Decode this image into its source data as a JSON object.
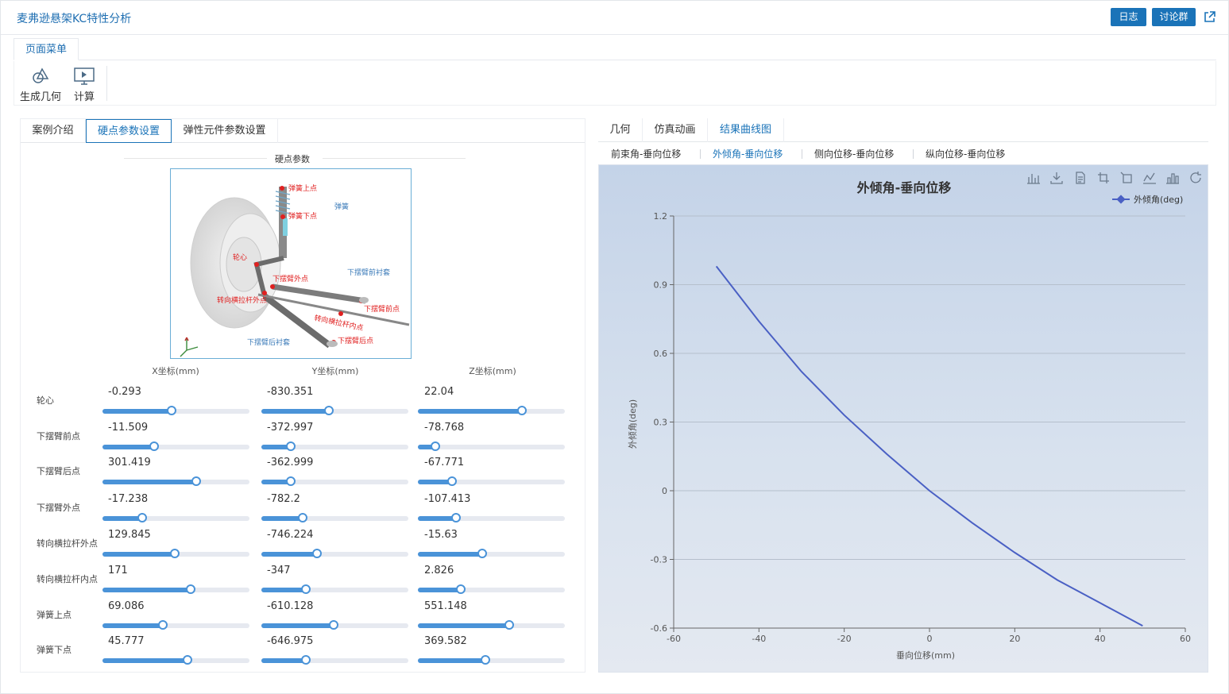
{
  "header": {
    "title": "麦弗逊悬架KC特性分析",
    "log_button": "日志",
    "discuss_button": "讨论群"
  },
  "menu": {
    "tab_label": "页面菜单",
    "tools": [
      {
        "label": "生成几何",
        "icon": "geometry-shapes-icon"
      },
      {
        "label": "计算",
        "icon": "compute-monitor-icon"
      }
    ]
  },
  "left_tabs": [
    "案例介绍",
    "硬点参数设置",
    "弹性元件参数设置"
  ],
  "left_active_tab": "硬点参数设置",
  "hardpoint_section": {
    "title": "硬点参数",
    "columns": [
      "X坐标(mm)",
      "Y坐标(mm)",
      "Z坐标(mm)"
    ],
    "diagram_labels": [
      "弹簧上点",
      "弹簧",
      "弹簧下点",
      "轮心",
      "下摆臂外点",
      "下摆臂前衬套",
      "转向横拉杆外点",
      "下摆臂前点",
      "转向横拉杆内点",
      "下摆臂后衬套",
      "下摆臂后点"
    ],
    "rows": [
      {
        "label": "轮心",
        "values": [
          "-0.293",
          "-830.351",
          "22.04"
        ],
        "fractions": [
          0.47,
          0.46,
          0.71
        ]
      },
      {
        "label": "下摆臂前点",
        "values": [
          "-11.509",
          "-372.997",
          "-78.768"
        ],
        "fractions": [
          0.35,
          0.2,
          0.12
        ]
      },
      {
        "label": "下摆臂后点",
        "values": [
          "301.419",
          "-362.999",
          "-67.771"
        ],
        "fractions": [
          0.64,
          0.2,
          0.23
        ]
      },
      {
        "label": "下摆臂外点",
        "values": [
          "-17.238",
          "-782.2",
          "-107.413"
        ],
        "fractions": [
          0.27,
          0.28,
          0.26
        ]
      },
      {
        "label": "转向横拉杆外点",
        "values": [
          "129.845",
          "-746.224",
          "-15.63"
        ],
        "fractions": [
          0.49,
          0.38,
          0.44
        ]
      },
      {
        "label": "转向横拉杆内点",
        "values": [
          "171",
          "-347",
          "2.826"
        ],
        "fractions": [
          0.6,
          0.3,
          0.29
        ]
      },
      {
        "label": "弹簧上点",
        "values": [
          "69.086",
          "-610.128",
          "551.148"
        ],
        "fractions": [
          0.41,
          0.49,
          0.62
        ]
      },
      {
        "label": "弹簧下点",
        "values": [
          "45.777",
          "-646.975",
          "369.582"
        ],
        "fractions": [
          0.58,
          0.3,
          0.46
        ]
      }
    ]
  },
  "right_tabs": [
    "几何",
    "仿真动画",
    "结果曲线图"
  ],
  "right_active_tab": "结果曲线图",
  "sub_tabs": [
    "前束角-垂向位移",
    "外倾角-垂向位移",
    "侧向位移-垂向位移",
    "纵向位移-垂向位移"
  ],
  "sub_active": "外倾角-垂向位移",
  "chart_tools": [
    "bar-stack-icon",
    "download-icon",
    "data-view-icon",
    "zoom-icon",
    "zoom-reset-icon",
    "line-chart-icon",
    "bar-chart-icon",
    "refresh-icon"
  ],
  "chart_data": {
    "type": "line",
    "title": "外倾角-垂向位移",
    "xlabel": "垂向位移(mm)",
    "ylabel": "外倾角(deg)",
    "xlim": [
      -60,
      60
    ],
    "ylim": [
      -0.6,
      1.2
    ],
    "xticks": [
      -60,
      -40,
      -20,
      0,
      20,
      40,
      60
    ],
    "yticks": [
      -0.6,
      -0.3,
      0,
      0.3,
      0.6,
      0.9,
      1.2
    ],
    "legend": "top-right",
    "grid": true,
    "series": [
      {
        "name": "外倾角(deg)",
        "color": "#4a60c4",
        "x": [
          -50,
          -40,
          -30,
          -20,
          -10,
          0,
          10,
          20,
          30,
          40,
          50
        ],
        "y": [
          0.98,
          0.74,
          0.52,
          0.33,
          0.16,
          0.0,
          -0.14,
          -0.27,
          -0.39,
          -0.49,
          -0.59
        ]
      }
    ]
  }
}
